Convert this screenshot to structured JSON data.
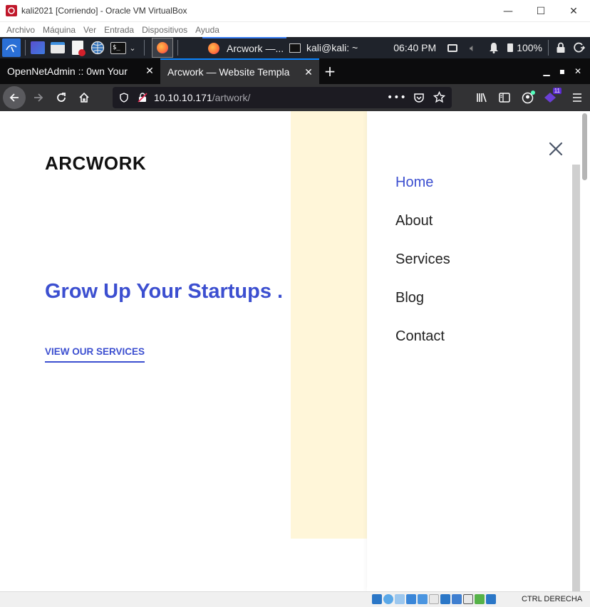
{
  "vbox": {
    "title": "kali2021 [Corriendo] - Oracle VM VirtualBox",
    "menu": [
      "Archivo",
      "Máquina",
      "Ver",
      "Entrada",
      "Dispositivos",
      "Ayuda"
    ],
    "host_key": "CTRL DERECHA"
  },
  "kali_panel": {
    "task_firefox": "Arcwork —...",
    "task_terminal": "kali@kali: ~",
    "clock": "06:40 PM",
    "battery": "100%"
  },
  "firefox": {
    "tabs": [
      {
        "title": "OpenNetAdmin :: 0wn Your",
        "selected": false
      },
      {
        "title": "Arcwork — Website Templa",
        "selected": true
      }
    ],
    "url_host": "10.10.10.171",
    "url_path": "/artwork/",
    "extension_badge": "11"
  },
  "page": {
    "logo": "ARCWORK",
    "hero_title": "Grow Up Your Startups .",
    "hero_link": "VIEW OUR SERVICES",
    "menu": [
      {
        "label": "Home",
        "active": true
      },
      {
        "label": "About",
        "active": false
      },
      {
        "label": "Services",
        "active": false
      },
      {
        "label": "Blog",
        "active": false
      },
      {
        "label": "Contact",
        "active": false
      }
    ],
    "colors": {
      "accent": "#3c4fd0",
      "highlight_block": "#fff6d9"
    }
  }
}
